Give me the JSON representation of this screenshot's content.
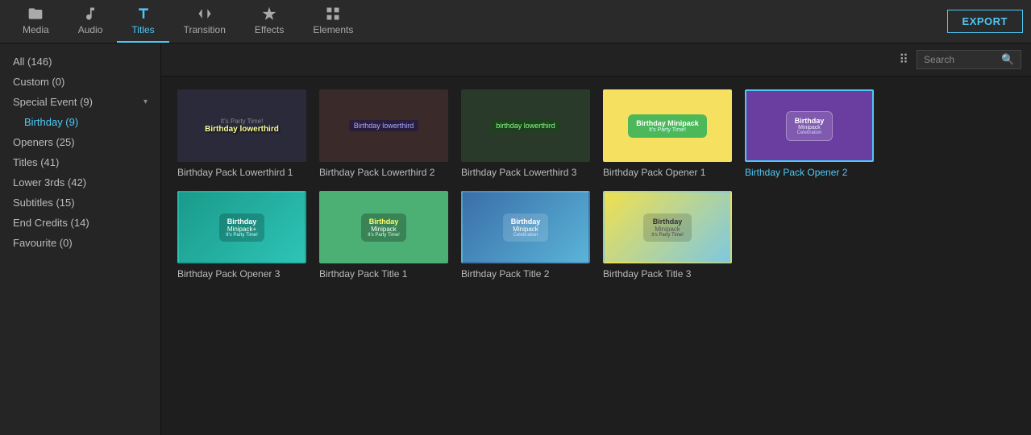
{
  "toolbar": {
    "export_label": "EXPORT",
    "items": [
      {
        "id": "media",
        "label": "Media",
        "icon": "folder"
      },
      {
        "id": "audio",
        "label": "Audio",
        "icon": "music"
      },
      {
        "id": "titles",
        "label": "Titles",
        "icon": "T",
        "active": true
      },
      {
        "id": "transition",
        "label": "Transition",
        "icon": "transition"
      },
      {
        "id": "effects",
        "label": "Effects",
        "icon": "effects"
      },
      {
        "id": "elements",
        "label": "Elements",
        "icon": "elements"
      }
    ]
  },
  "sidebar": {
    "items": [
      {
        "id": "all",
        "label": "All (146)",
        "active": false
      },
      {
        "id": "custom",
        "label": "Custom (0)",
        "active": false
      },
      {
        "id": "special-event",
        "label": "Special Event (9)",
        "active": false,
        "has-chevron": true
      },
      {
        "id": "birthday",
        "label": "Birthday (9)",
        "active": true,
        "indent": true
      },
      {
        "id": "openers",
        "label": "Openers (25)",
        "active": false
      },
      {
        "id": "titles",
        "label": "Titles (41)",
        "active": false
      },
      {
        "id": "lower3rds",
        "label": "Lower 3rds (42)",
        "active": false
      },
      {
        "id": "subtitles",
        "label": "Subtitles (15)",
        "active": false
      },
      {
        "id": "endcredits",
        "label": "End Credits (14)",
        "active": false
      },
      {
        "id": "favourite",
        "label": "Favourite (0)",
        "active": false
      }
    ]
  },
  "search": {
    "placeholder": "Search",
    "value": ""
  },
  "grid": {
    "items": [
      {
        "id": "bplt1",
        "label": "Birthday Pack Lowerthird 1",
        "theme": "dark",
        "selected": false,
        "row": 0
      },
      {
        "id": "bplt2",
        "label": "Birthday Pack Lowerthird 2",
        "theme": "dark2",
        "selected": false,
        "row": 0
      },
      {
        "id": "bplt3",
        "label": "Birthday Pack Lowerthird 3",
        "theme": "dark3",
        "selected": false,
        "row": 0
      },
      {
        "id": "bpo1",
        "label": "Birthday Pack Opener 1",
        "theme": "yellow",
        "selected": false,
        "row": 0
      },
      {
        "id": "bpo2",
        "label": "Birthday Pack Opener 2",
        "theme": "purple",
        "selected": true,
        "row": 0
      },
      {
        "id": "bpo3",
        "label": "Birthday Pack Opener 3",
        "theme": "teal",
        "selected": false,
        "row": 0
      },
      {
        "id": "bpt1",
        "label": "Birthday Pack Title 1",
        "theme": "green",
        "selected": false,
        "row": 1
      },
      {
        "id": "bpt2",
        "label": "Birthday Pack Title 2",
        "theme": "blue-grad",
        "selected": false,
        "row": 1
      },
      {
        "id": "bpt3",
        "label": "Birthday Pack Title 3",
        "theme": "colorful",
        "selected": false,
        "row": 1
      }
    ]
  }
}
